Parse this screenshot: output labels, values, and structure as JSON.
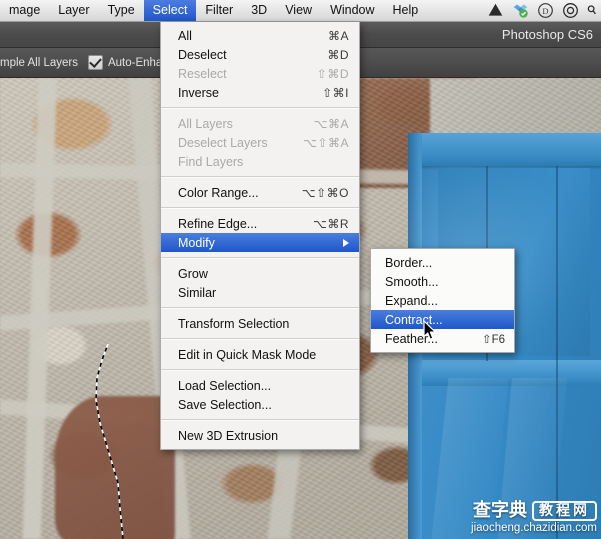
{
  "menubar": {
    "items": [
      {
        "label": "mage",
        "name": "menubar-item-image",
        "active": false
      },
      {
        "label": "Layer",
        "name": "menubar-item-layer",
        "active": false
      },
      {
        "label": "Type",
        "name": "menubar-item-type",
        "active": false
      },
      {
        "label": "Select",
        "name": "menubar-item-select",
        "active": true
      },
      {
        "label": "Filter",
        "name": "menubar-item-filter",
        "active": false
      },
      {
        "label": "3D",
        "name": "menubar-item-3d",
        "active": false
      },
      {
        "label": "View",
        "name": "menubar-item-view",
        "active": false
      },
      {
        "label": "Window",
        "name": "menubar-item-window",
        "active": false
      },
      {
        "label": "Help",
        "name": "menubar-item-help",
        "active": false
      }
    ],
    "tray": [
      {
        "name": "google-drive-icon",
        "color": "#2a2a2a"
      },
      {
        "name": "dropbox-sync-icon",
        "color": "#4ba3dd"
      },
      {
        "name": "dropbox-icon",
        "color": "#3a3a3a"
      },
      {
        "name": "creative-cloud-icon",
        "color": "#2a2a2a"
      },
      {
        "name": "spotlight-icon",
        "color": "#2a2a2a"
      }
    ]
  },
  "titlebar": {
    "title": "Photoshop CS6"
  },
  "optionsbar": {
    "sample_all_layers_label": "mple All Layers",
    "auto_enhance_label": "Auto-Enhance",
    "auto_enhance_checked": true
  },
  "select_menu": {
    "groups": [
      {
        "items": [
          {
            "label": "All",
            "shortcut": "⌘A",
            "disabled": false,
            "highlighted": false,
            "submenu": false
          },
          {
            "label": "Deselect",
            "shortcut": "⌘D",
            "disabled": false,
            "highlighted": false,
            "submenu": false
          },
          {
            "label": "Reselect",
            "shortcut": "⇧⌘D",
            "disabled": true,
            "highlighted": false,
            "submenu": false
          },
          {
            "label": "Inverse",
            "shortcut": "⇧⌘I",
            "disabled": false,
            "highlighted": false,
            "submenu": false
          }
        ]
      },
      {
        "items": [
          {
            "label": "All Layers",
            "shortcut": "⌥⌘A",
            "disabled": true,
            "highlighted": false,
            "submenu": false
          },
          {
            "label": "Deselect Layers",
            "shortcut": "⌥⇧⌘A",
            "disabled": true,
            "highlighted": false,
            "submenu": false
          },
          {
            "label": "Find Layers",
            "shortcut": "",
            "disabled": true,
            "highlighted": false,
            "submenu": false
          }
        ]
      },
      {
        "items": [
          {
            "label": "Color Range...",
            "shortcut": "⌥⇧⌘O",
            "disabled": false,
            "highlighted": false,
            "submenu": false
          }
        ]
      },
      {
        "items": [
          {
            "label": "Refine Edge...",
            "shortcut": "⌥⌘R",
            "disabled": false,
            "highlighted": false,
            "submenu": false
          },
          {
            "label": "Modify",
            "shortcut": "",
            "disabled": false,
            "highlighted": true,
            "submenu": true
          }
        ]
      },
      {
        "items": [
          {
            "label": "Grow",
            "shortcut": "",
            "disabled": false,
            "highlighted": false,
            "submenu": false
          },
          {
            "label": "Similar",
            "shortcut": "",
            "disabled": false,
            "highlighted": false,
            "submenu": false
          }
        ]
      },
      {
        "items": [
          {
            "label": "Transform Selection",
            "shortcut": "",
            "disabled": false,
            "highlighted": false,
            "submenu": false
          }
        ]
      },
      {
        "items": [
          {
            "label": "Edit in Quick Mask Mode",
            "shortcut": "",
            "disabled": false,
            "highlighted": false,
            "submenu": false
          }
        ]
      },
      {
        "items": [
          {
            "label": "Load Selection...",
            "shortcut": "",
            "disabled": false,
            "highlighted": false,
            "submenu": false
          },
          {
            "label": "Save Selection...",
            "shortcut": "",
            "disabled": false,
            "highlighted": false,
            "submenu": false
          }
        ]
      },
      {
        "items": [
          {
            "label": "New 3D Extrusion",
            "shortcut": "",
            "disabled": false,
            "highlighted": false,
            "submenu": false
          }
        ]
      }
    ]
  },
  "modify_submenu": {
    "items": [
      {
        "label": "Border...",
        "shortcut": "",
        "highlighted": false
      },
      {
        "label": "Smooth...",
        "shortcut": "",
        "highlighted": false
      },
      {
        "label": "Expand...",
        "shortcut": "",
        "highlighted": false
      },
      {
        "label": "Contract...",
        "shortcut": "",
        "highlighted": true
      },
      {
        "label": "Feather...",
        "shortcut": "⇧F6",
        "highlighted": false
      }
    ]
  },
  "watermark": {
    "brand_cn": "查字典",
    "boxed_cn": "教程网",
    "url": "jiaocheng.chazidian.com"
  },
  "colors": {
    "menu_highlight": "#1f56c9",
    "door_blue": "#3d8ec9",
    "chrome_dark": "#4b4b4b",
    "menubar_bg": "#e4e4e4"
  }
}
